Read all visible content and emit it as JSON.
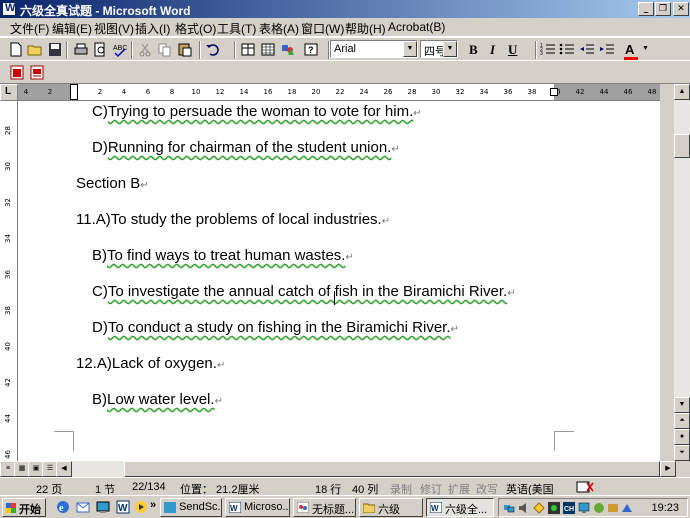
{
  "window": {
    "title": "六级全真试题 - Microsoft Word",
    "minimize_label": "_",
    "maximize_label": "❐",
    "close_label": "✕"
  },
  "menu": [
    {
      "label": "文件(F)"
    },
    {
      "label": "编辑(E)"
    },
    {
      "label": "视图(V)"
    },
    {
      "label": "插入(I)"
    },
    {
      "label": "格式(O)"
    },
    {
      "label": "工具(T)"
    },
    {
      "label": "表格(A)"
    },
    {
      "label": "窗口(W)"
    },
    {
      "label": "帮助(H)"
    },
    {
      "label": "Acrobat(B)"
    }
  ],
  "formatting": {
    "font_name": "Arial",
    "font_size": "四号",
    "bold_label": "B",
    "italic_label": "I",
    "underline_label": "U",
    "font_color_label": "A"
  },
  "ruler": {
    "h_ticks": [
      "4",
      "2",
      "2",
      "4",
      "6",
      "8",
      "10",
      "12",
      "14",
      "16",
      "18",
      "20",
      "22",
      "24",
      "26",
      "28",
      "30",
      "32",
      "34",
      "36",
      "38",
      "40",
      "42",
      "44",
      "46",
      "48"
    ],
    "v_ticks": [
      "28",
      "30",
      "32",
      "34",
      "36",
      "38",
      "40",
      "42",
      "44",
      "46"
    ]
  },
  "document": {
    "lines": [
      {
        "prefix": "C)",
        "text": "Trying to persuade the woman to vote for him.",
        "indent": true
      },
      {
        "prefix": "D)",
        "text": "Running for chairman of the student union.",
        "indent": true
      },
      {
        "prefix": "",
        "text": "Section B",
        "indent": false
      },
      {
        "prefix": "11.A)",
        "text": "To study the problems of local industries.",
        "indent": false
      },
      {
        "prefix": "B)",
        "text": "To find ways to treat human wastes.",
        "indent": true
      },
      {
        "prefix": "C)",
        "text": "To investigate the annual catch of fish in the Biramichi River.",
        "indent": true
      },
      {
        "prefix": "D)",
        "text": "To conduct a study on fishing in the Biramichi River.",
        "indent": true
      },
      {
        "prefix": "12.A)",
        "text": "Lack of oxygen.",
        "indent": false
      },
      {
        "prefix": "B)",
        "text": "Low water level.",
        "indent": true
      }
    ],
    "paragraph_mark": "↵"
  },
  "status": {
    "page": "22 页",
    "section": "1 节",
    "page_of": "22/134",
    "position": "位置： 21.2厘米",
    "line": "18 行",
    "column": "40 列",
    "rec": "录制",
    "trk": "修订",
    "ext": "扩展",
    "ovr": "改写",
    "language": "英语(美国"
  },
  "taskbar": {
    "start_label": "开始",
    "more_label": "»",
    "buttons": [
      {
        "label": "SendSc..."
      },
      {
        "label": "Microso..."
      },
      {
        "label": "无标题..."
      },
      {
        "label": "六级"
      },
      {
        "label": "六级全..."
      }
    ],
    "clock": "19:23"
  }
}
